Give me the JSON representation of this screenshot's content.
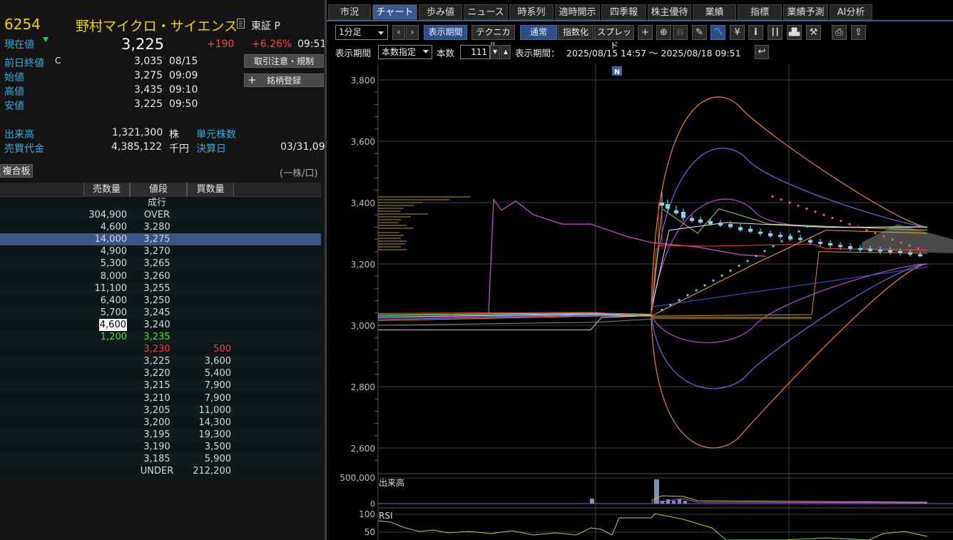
{
  "quote": {
    "code": "6254",
    "name": "野村マイクロ・サイエンス",
    "market": "東証 P",
    "current_label": "現在値",
    "current_price": "3,225",
    "change": "+190",
    "change_pct": "+6.26%",
    "current_time": "09:51",
    "prev_close_label": "前日終値",
    "prev_close_flag": "C",
    "prev_close": "3,035",
    "prev_close_date": "08/15",
    "open_label": "始値",
    "open": "3,275",
    "open_time": "09:09",
    "high_label": "高値",
    "high": "3,435",
    "high_time": "09:10",
    "low_label": "安値",
    "low": "3,225",
    "low_time": "09:50",
    "volume_label": "出来高",
    "volume": "1,321,300",
    "volume_unit": "株",
    "unit_shares_label": "単元株数",
    "turnover_label": "売買代金",
    "turnover": "4,385,122",
    "turnover_unit": "千円",
    "settlement_label": "決算日",
    "settlement": "03/31,09"
  },
  "side_buttons": {
    "caution": "取引注意・規制",
    "register": "銘柄登録"
  },
  "board": {
    "toggle": "複合板",
    "unit": "(一株/口)",
    "headers": {
      "sell": "売数量",
      "price": "値段",
      "buy": "買数量"
    },
    "rows": [
      {
        "sell": "",
        "price": "成行",
        "buy": ""
      },
      {
        "sell": "304,900",
        "price": "OVER",
        "buy": ""
      },
      {
        "sell": "4,600",
        "price": "3,280",
        "buy": ""
      },
      {
        "sell": "14,000",
        "price": "3,275",
        "buy": ""
      },
      {
        "sell": "4,900",
        "price": "3,270",
        "buy": ""
      },
      {
        "sell": "5,300",
        "price": "3,265",
        "buy": ""
      },
      {
        "sell": "8,000",
        "price": "3,260",
        "buy": ""
      },
      {
        "sell": "11,100",
        "price": "3,255",
        "buy": ""
      },
      {
        "sell": "6,400",
        "price": "3,250",
        "buy": ""
      },
      {
        "sell": "5,700",
        "price": "3,245",
        "buy": ""
      },
      {
        "sell": "4,600",
        "price": "3,240",
        "buy": ""
      },
      {
        "sell": "1,200",
        "price": "3,235",
        "buy": ""
      },
      {
        "sell": "",
        "price": "3,230",
        "buy": "500"
      },
      {
        "sell": "",
        "price": "3,225",
        "buy": "3,600"
      },
      {
        "sell": "",
        "price": "3,220",
        "buy": "5,400"
      },
      {
        "sell": "",
        "price": "3,215",
        "buy": "7,900"
      },
      {
        "sell": "",
        "price": "3,210",
        "buy": "7,900"
      },
      {
        "sell": "",
        "price": "3,205",
        "buy": "11,000"
      },
      {
        "sell": "",
        "price": "3,200",
        "buy": "14,300"
      },
      {
        "sell": "",
        "price": "3,195",
        "buy": "19,300"
      },
      {
        "sell": "",
        "price": "3,190",
        "buy": "3,500"
      },
      {
        "sell": "",
        "price": "3,185",
        "buy": "5,900"
      },
      {
        "sell": "",
        "price": "UNDER",
        "buy": "212,200"
      }
    ]
  },
  "tabs": [
    "市況",
    "チャート",
    "歩み値",
    "ニュース",
    "時系列",
    "適時開示",
    "四季報",
    "株主優待",
    "業績",
    "指標",
    "業績予測",
    "AI分析"
  ],
  "active_tab": "チャート",
  "toolbar": {
    "interval": "1分足",
    "period_btn": "表示期間",
    "technical_btn": "テクニカル",
    "normal_btn": "通常",
    "index_btn": "指数化",
    "spread_btn": "スプレッド",
    "yen_icon": "¥",
    "info_icon": "i"
  },
  "period_row": {
    "label": "表示期間",
    "mode": "本数指定",
    "count_label": "本数",
    "count": "111",
    "range_label": "表示期間：",
    "range": "2025/08/15 14:57 〜 2025/08/18 09:51"
  },
  "chart_data": {
    "type": "line",
    "news_marker": "N",
    "y_ticks": [
      "3,800",
      "3,600",
      "3,400",
      "3,200",
      "3,000",
      "2,800",
      "2,600"
    ],
    "ylim": [
      2550,
      3840
    ],
    "volume_label": "出来高",
    "volume_tick": "500,000",
    "volume_zero": "0",
    "rsi_label": "RSI",
    "rsi_ticks": [
      "100",
      "50"
    ]
  }
}
